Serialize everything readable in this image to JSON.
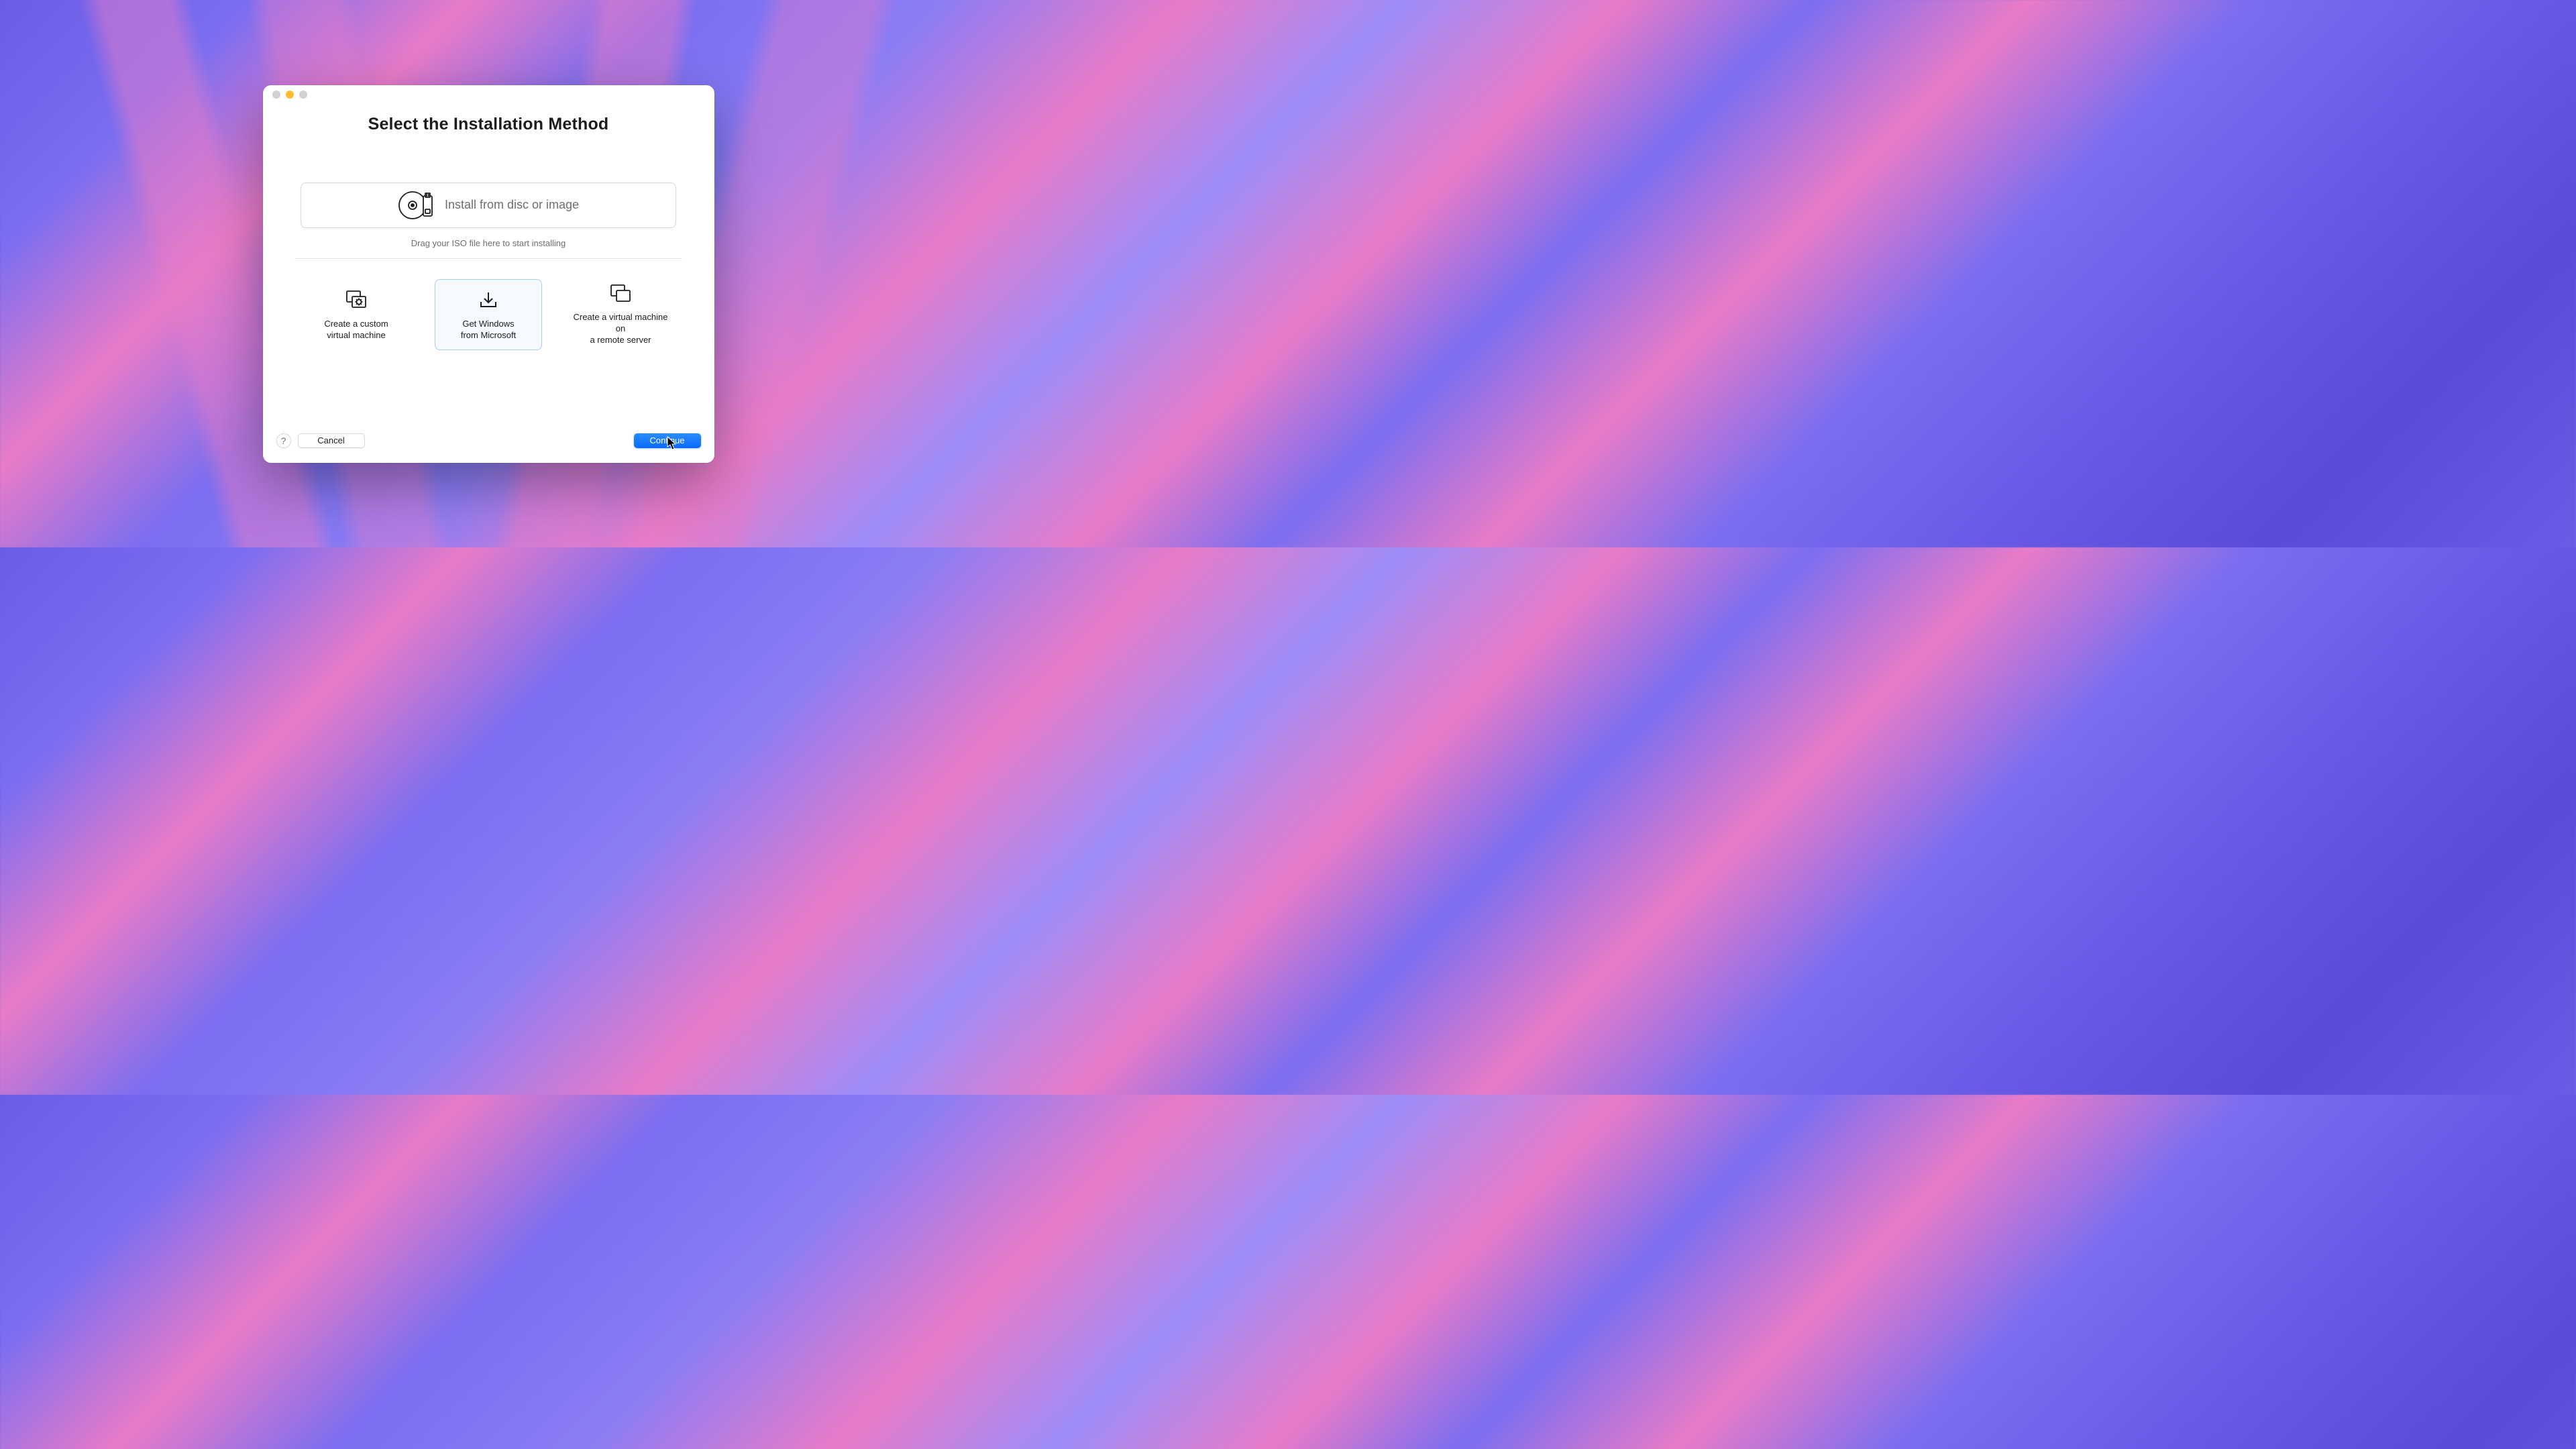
{
  "dialog": {
    "title": "Select the Installation Method",
    "disc_option_label": "Install from disc or image",
    "drag_hint": "Drag your ISO file here to start installing",
    "options": [
      {
        "label": "Create a custom\nvirtual machine"
      },
      {
        "label": "Get Windows\nfrom Microsoft"
      },
      {
        "label": "Create a virtual machine on\na remote server"
      }
    ],
    "selected_option_index": 1
  },
  "footer": {
    "help_label": "?",
    "cancel_label": "Cancel",
    "continue_label": "Continue"
  },
  "icons": {
    "disc": "disc-usb-icon",
    "custom_vm": "settings-icon",
    "download": "download-icon",
    "remote": "remote-display-icon",
    "cursor": "cursor-icon"
  },
  "colors": {
    "accent": "#0a6bff",
    "selection_border": "#a6cdf2",
    "selection_bg": "#f4faff"
  }
}
